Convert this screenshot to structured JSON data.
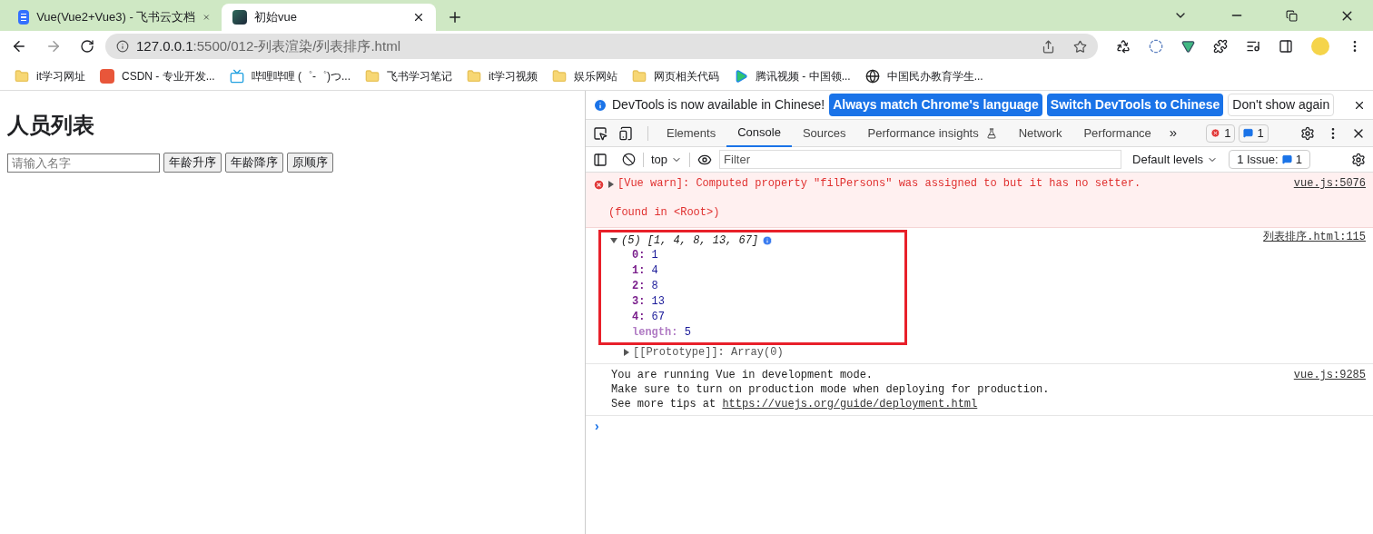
{
  "browser": {
    "tabs": [
      {
        "title": "Vue(Vue2+Vue3) - 飞书云文档",
        "kind": "doc",
        "selected": false
      },
      {
        "title": "初始vue",
        "kind": "app",
        "selected": true
      }
    ],
    "address": {
      "host": "127.0.0.1",
      "path": ":5500/012-列表渲染/列表排序.html"
    },
    "bookmarks": [
      {
        "label": "it学习网址",
        "kind": "folder"
      },
      {
        "label": "CSDN - 专业开发...",
        "kind": "csdn"
      },
      {
        "label": "哔哩哔哩 (゜-゜)つ...",
        "kind": "tv"
      },
      {
        "label": "飞书学习笔记",
        "kind": "folder"
      },
      {
        "label": "it学习视频",
        "kind": "folder"
      },
      {
        "label": "娱乐网站",
        "kind": "folder"
      },
      {
        "label": "网页相关代码",
        "kind": "folder"
      },
      {
        "label": "腾讯视频 - 中国领...",
        "kind": "play"
      },
      {
        "label": "中国民办教育学生...",
        "kind": "globe"
      }
    ]
  },
  "page": {
    "heading": "人员列表",
    "search": {
      "placeholder": "请输入名字"
    },
    "buttons": [
      "年龄升序",
      "年龄降序",
      "原顺序"
    ]
  },
  "devtools": {
    "infobar": {
      "message": "DevTools is now available in Chinese!",
      "buttons": [
        "Always match Chrome's language",
        "Switch DevTools to Chinese"
      ],
      "dismiss": "Don't show again"
    },
    "tabs": [
      {
        "label": "Elements",
        "selected": false
      },
      {
        "label": "Console",
        "selected": true
      },
      {
        "label": "Sources",
        "selected": false
      },
      {
        "label": "Performance insights",
        "selected": false
      },
      {
        "label": "Network",
        "selected": false
      },
      {
        "label": "Performance",
        "selected": false
      }
    ],
    "more": "»",
    "error_count": "1",
    "message_count": "1",
    "console_toolbar": {
      "context": "top",
      "filter": {
        "placeholder": "Filter"
      },
      "levels": "Default levels",
      "issues": "1 Issue:",
      "issue_count": "1"
    },
    "messages": [
      {
        "kind": "error",
        "text": "[Vue warn]: Computed property \"filPersons\" was assigned to but it has no setter.",
        "detail": "(found in <Root>)",
        "source": "vue.js:5076"
      },
      {
        "kind": "array",
        "summary": "(5) [1, 4, 8, 13, 67]",
        "source": "列表排序.html:115",
        "expanded": true,
        "highlighted": true,
        "entries": [
          {
            "key": "0:",
            "value": "1"
          },
          {
            "key": "1:",
            "value": "4"
          },
          {
            "key": "2:",
            "value": "8"
          },
          {
            "key": "3:",
            "value": "13"
          },
          {
            "key": "4:",
            "value": "67"
          },
          {
            "key": "length:",
            "value": "5"
          }
        ],
        "prototype": "[[Prototype]]: Array(0)"
      },
      {
        "kind": "log",
        "lines": [
          "You are running Vue in development mode.",
          "Make sure to turn on production mode when deploying for production."
        ],
        "tip": "See more tips at",
        "link": "https://vuejs.org/guide/deployment.html",
        "source": "vue.js:9285"
      }
    ],
    "prompt": "›"
  }
}
